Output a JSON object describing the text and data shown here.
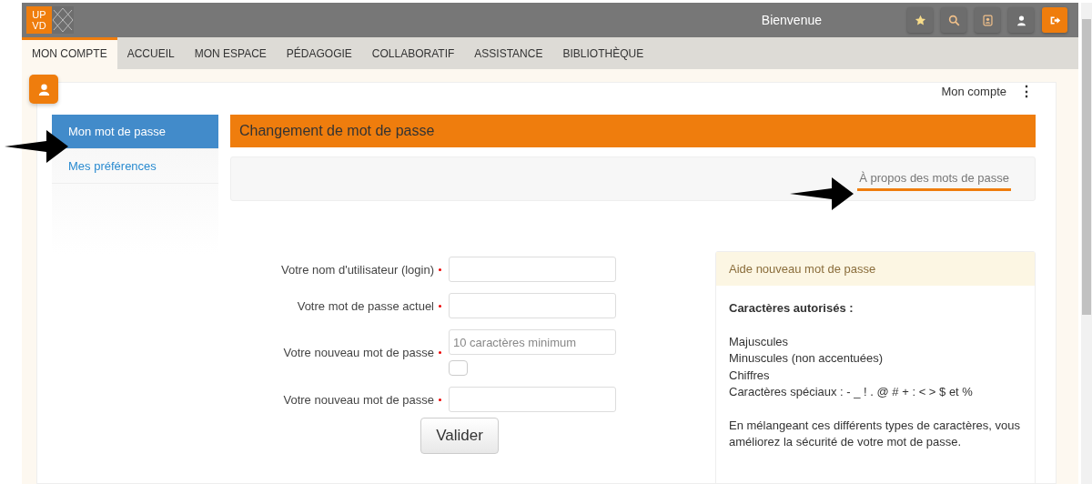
{
  "topbar": {
    "logo": [
      "UP",
      "VD"
    ],
    "title": "Bienvenue",
    "buttons": [
      {
        "kind": "star",
        "highlighted": false
      },
      {
        "kind": "search",
        "highlighted": false
      },
      {
        "kind": "contacts",
        "highlighted": false
      },
      {
        "kind": "user",
        "highlighted": false
      },
      {
        "kind": "logout",
        "highlighted": true
      }
    ]
  },
  "nav": [
    {
      "label": "MON COMPTE",
      "selected": true
    },
    {
      "label": "ACCUEIL",
      "selected": false
    },
    {
      "label": "MON ESPACE",
      "selected": false
    },
    {
      "label": "PÉDAGOGIE",
      "selected": false
    },
    {
      "label": "COLLABORATIF",
      "selected": false
    },
    {
      "label": "ASSISTANCE",
      "selected": false
    },
    {
      "label": "BIBLIOTHÈQUE",
      "selected": false
    }
  ],
  "page_header": {
    "title": "Mon compte",
    "menu": "⋮"
  },
  "sidebar": [
    {
      "label": "Mon mot de passe",
      "selected": true
    },
    {
      "label": "Mes préférences",
      "selected": false
    }
  ],
  "heading": "Changement de mot de passe",
  "info_link": "À propos des mots de passe",
  "form": {
    "fields": [
      {
        "kind": "input",
        "label": "Votre nom d'utilisateur (login)",
        "required": true
      },
      {
        "kind": "input",
        "label": "Votre mot de passe actuel",
        "required": true
      },
      {
        "kind": "input",
        "label": "Votre nouveau mot de passe",
        "required": true,
        "placeholder": "10 caractères minimum",
        "checkbox": {
          "checked": false
        }
      },
      {
        "kind": "input",
        "label": "Votre nouveau mot de passe",
        "required": true
      }
    ],
    "submit": "Valider"
  },
  "help": {
    "title": "Aide nouveau mot de passe",
    "subtitle": "Caractères autorisés :",
    "lines": [
      "Majuscules",
      "Minuscules (non accentuées)",
      "Chiffres",
      "Caractères spéciaux : - _ ! . @ # + : < > $ et %"
    ],
    "paragraph": "En mélangeant ces différents types de caractères, vous améliorez la sécurité de votre mot de passe."
  }
}
